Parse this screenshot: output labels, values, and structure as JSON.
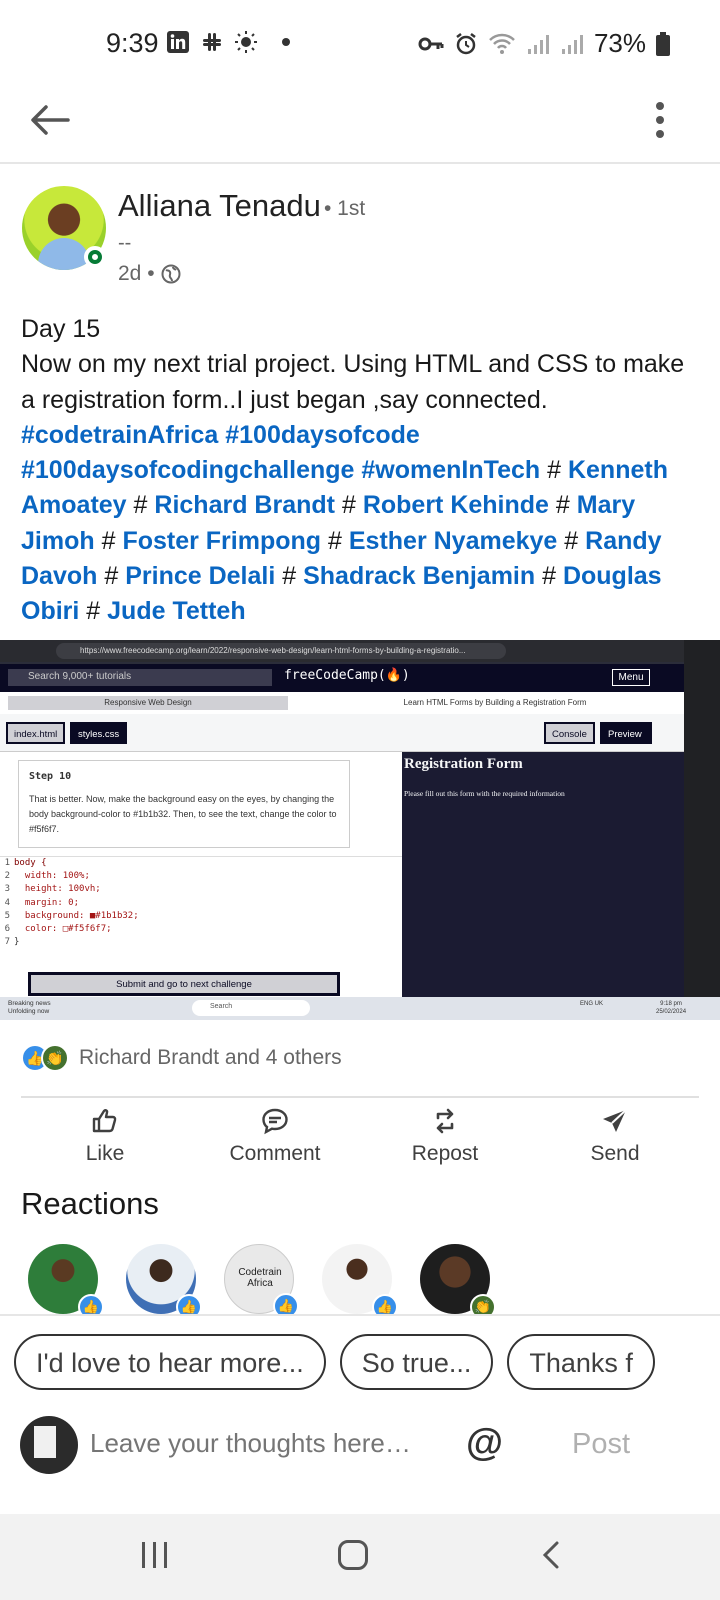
{
  "status_bar": {
    "time": "9:39",
    "battery": "73%",
    "left_icons": [
      "linkedin-icon",
      "slack-icon",
      "brightness-icon",
      "dot-icon"
    ],
    "right_icons": [
      "vpn-key-icon",
      "alarm-icon",
      "wifi-icon",
      "signal-icon",
      "signal-icon",
      "battery-icon"
    ]
  },
  "post": {
    "author": "Alliana Tenadu",
    "degree": "• 1st",
    "headline": "--",
    "age": "2d •",
    "paragraphs": {
      "line1": "Day 15",
      "line2": "Now on my next trial project. Using HTML and CSS to make a registration form..I just began ,say connected."
    },
    "tags": [
      "#codetrainAfrica",
      "#100daysofcode",
      "#100daysofcodingchallenge",
      "#womenInTech",
      "Kenneth Amoatey",
      "Richard Brandt",
      "Robert Kehinde",
      "Mary Jimoh",
      "Foster Frimpong",
      "Esther Nyamekye",
      "Randy Davoh",
      "Prince Delali",
      "Shadrack Benjamin",
      "Douglas Obiri",
      "Jude Tetteh"
    ],
    "hash": "#"
  },
  "screenshot": {
    "url": "https://www.freecodecamp.org/learn/2022/responsive-web-design/learn-html-forms-by-building-a-registratio...",
    "search": "Search 9,000+ tutorials",
    "logo": "freeCodeCamp(🔥)",
    "menu": "Menu",
    "crumb_a": "Responsive Web Design",
    "crumb_b": "Learn HTML Forms by Building a Registration Form",
    "tab_index": "index.html",
    "tab_styles": "styles.css",
    "console": "Console",
    "preview": "Preview",
    "step_title": "Step 10",
    "step_text": "That is better. Now, make the background easy on the eyes, by changing the body background-color to #1b1b32. Then, to see the text, change the color to #f5f6f7.",
    "code": [
      "body {",
      "  width: 100%;",
      "  height: 100vh;",
      "  margin: 0;",
      "  background: ■#1b1b32;",
      "  color: □#f5f6f7;",
      "}"
    ],
    "submit": "Submit and go to next challenge",
    "preview_title": "Registration Form",
    "preview_text": "Please fill out this form with the required information",
    "taskbar_news": "Breaking news",
    "taskbar_news_sub": "Unfolding now",
    "taskbar_search": "Search",
    "taskbar_lang": "ENG UK",
    "taskbar_time": "9:18 pm",
    "taskbar_date": "25/02/2024"
  },
  "social": {
    "reactions_text": "Richard Brandt and 4 others",
    "actions": [
      "Like",
      "Comment",
      "Repost",
      "Send"
    ],
    "reactions_title": "Reactions",
    "reactor_label": "Codetrain Africa"
  },
  "composer": {
    "chips": [
      "I'd love to hear more...",
      "So true...",
      "Thanks f"
    ],
    "placeholder": "Leave your thoughts here…",
    "at": "@",
    "post": "Post"
  },
  "colors": {
    "link": "#0a66c2",
    "online": "#067b36",
    "like": "#378fe9",
    "celebrate": "#44712e"
  }
}
